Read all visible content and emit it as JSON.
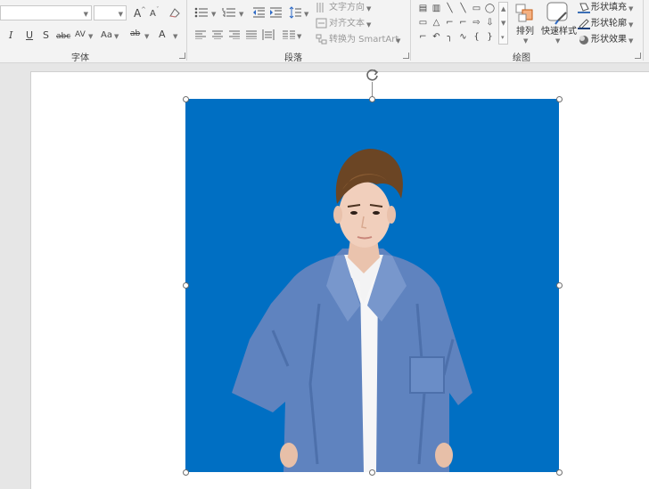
{
  "ribbon": {
    "font_group": {
      "label": "字体",
      "font_name_value": "",
      "font_size_value": "",
      "grow_glyph": "A",
      "shrink_glyph": "A",
      "clear_glyph": "A",
      "italic": "I",
      "underline": "U",
      "shadow": "S",
      "strike": "abc",
      "spacing": "AV",
      "case": "Aa",
      "highlight": "ab",
      "color": "A"
    },
    "paragraph_group": {
      "label": "段落",
      "text_direction": "文字方向",
      "align_text": "对齐文本",
      "smartart": "转换为 SmartArt"
    },
    "drawing_group": {
      "label": "绘图",
      "arrange": "排列",
      "quick_styles": "快速样式",
      "shape_fill": "形状填充",
      "shape_outline": "形状轮廓",
      "shape_effects": "形状效果",
      "shapes_row1": [
        "▤",
        "▥",
        "╲",
        "╲",
        "▭",
        "◯"
      ],
      "shapes_row2": [
        "▭",
        "△",
        "⌐",
        "⌐",
        "⇨",
        "⇩"
      ],
      "shapes_row3": [
        "⌐",
        "↶",
        "╮",
        "∿",
        "{",
        "}"
      ]
    },
    "colors": {
      "fill_underline": "#3b6fb6",
      "outline_underline": "#1d3f7a"
    }
  },
  "slide": {
    "picture_bg_color": "#006fc3",
    "picture_subject": "person-portrait"
  }
}
